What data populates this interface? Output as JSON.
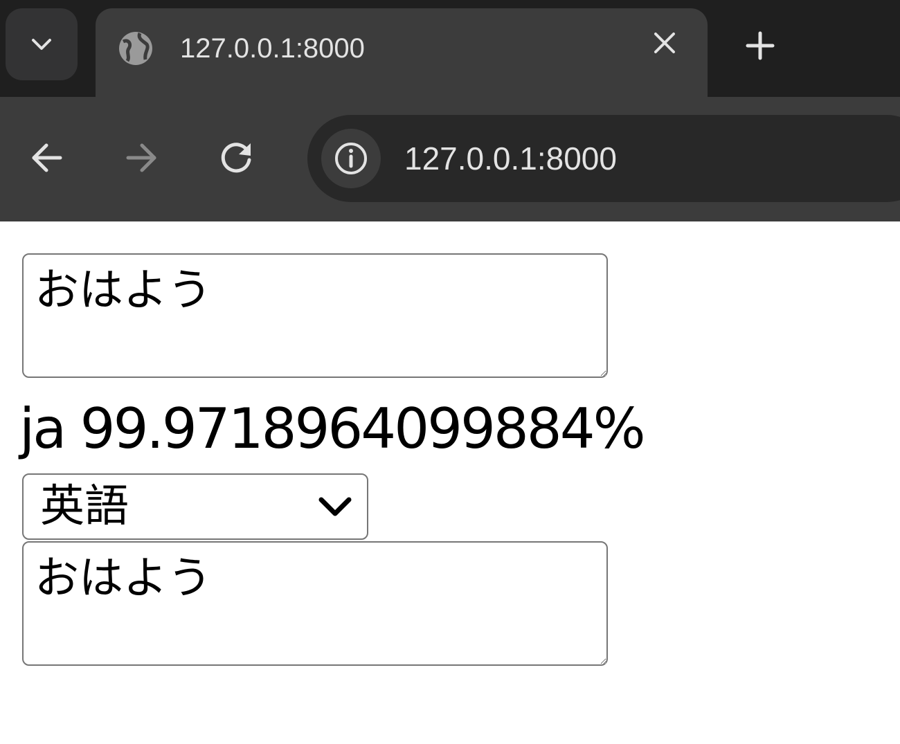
{
  "browser": {
    "tab": {
      "title": "127.0.0.1:8000",
      "favicon": "globe-icon"
    },
    "toolbar": {
      "url": "127.0.0.1:8000",
      "site_info_icon": "info-icon"
    },
    "colors": {
      "frame": "#1f1f1f",
      "toolbar": "#3c3c3c",
      "omnibox": "#282828",
      "text": "#e3e3e3",
      "disabled": "#8a8a8a"
    }
  },
  "page": {
    "source_text": "おはよう",
    "detected_language": "ja 99.9718964099884%",
    "target_language": {
      "selected": "英語"
    },
    "translated_text": "おはよう"
  }
}
